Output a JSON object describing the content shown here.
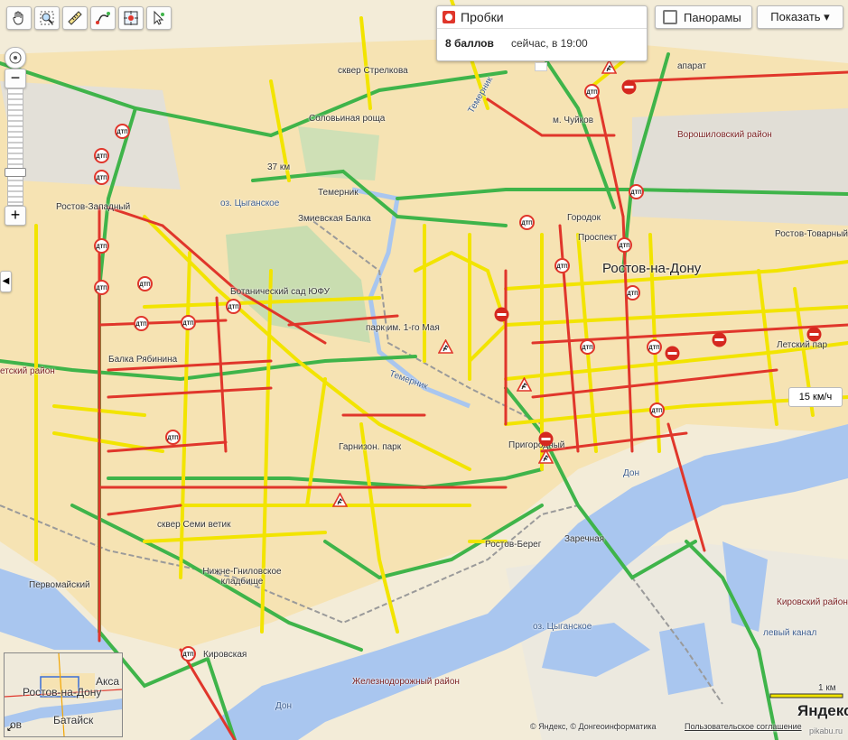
{
  "toolbar": {
    "tools": [
      "hand-icon",
      "zoom-rect-icon",
      "ruler-icon",
      "route-icon",
      "locate-icon",
      "cursor-icon"
    ]
  },
  "traffic": {
    "layer_label": "Пробки",
    "score": "8 баллов",
    "time": "сейчас, в 19:00"
  },
  "panoramas_label": "Панорамы",
  "show_label": "Показать ▾",
  "speed_badge": "15 км/ч",
  "map_labels": {
    "city": "Ростов-на-Дону",
    "district_voroshilovsky": "Ворошиловский район",
    "district_kirovsky": "Кировский район",
    "district_zheleznodorozhny": "Железнодорожный район",
    "district_sovetsky": "етский район",
    "district_leninsky": "Летский пар",
    "botanic_garden": "Ботанический сад ЮФУ",
    "solovinaya": "Соловьиная роща",
    "skver_strelkova": "сквер Стрелкова",
    "temernik1": "Темерник",
    "temernik2": "Темерник",
    "temernik3": "Темерник",
    "ozero_tsygan": "оз. Цыганское",
    "ozero_tsygan2": "оз. Цыганское",
    "zmievskaya": "Змиевская Балка",
    "rostov_zap": "Ростов-Западный",
    "balka_ryabinina": "Балка Рябинина",
    "skver_semi": "сквер Семи ветик",
    "nizhne_gnil": "Нижне-Гниловское кладбище",
    "prigorodny": "Пригородный",
    "rostov_bereg": "Ростов-Берег",
    "zarechnaya": "Заречная",
    "pervomayskiy": "Первомайский",
    "don1": "Дон",
    "don2": "Дон",
    "park_marta": "парк им. 1-го Мая",
    "park_revolution": "Гарнизон. парк",
    "km37": "37 км",
    "levoberezhny": "левый канал",
    "prospect": "Проспект",
    "chuyk": "м. Чуйков",
    "aparat": "апарат",
    "gorodok": "Городок",
    "rostov_tovarny": "Ростов-Товарный",
    "kirovsky_street": "Кировская"
  },
  "markers": {
    "dtp_label": "ДТП"
  },
  "minimap": {
    "city": "Ростов-на-Дону",
    "aksay": "Акса",
    "bataysk": "Батайск",
    "ov": "ов"
  },
  "scale": "1 км",
  "brand": "Яндекс",
  "copyright": "© Яндекс, © Донгеоинформатика",
  "terms": "Пользовательское соглашение",
  "watermark": "pikabu.ru",
  "colors": {
    "traffic_green": "#3fb44a",
    "traffic_yellow": "#f2e400",
    "traffic_red": "#e0362b",
    "water": "#a9c6ef",
    "urban": "#f5e6b8",
    "park": "#c9ddb0",
    "industrial": "#dedbd2"
  }
}
